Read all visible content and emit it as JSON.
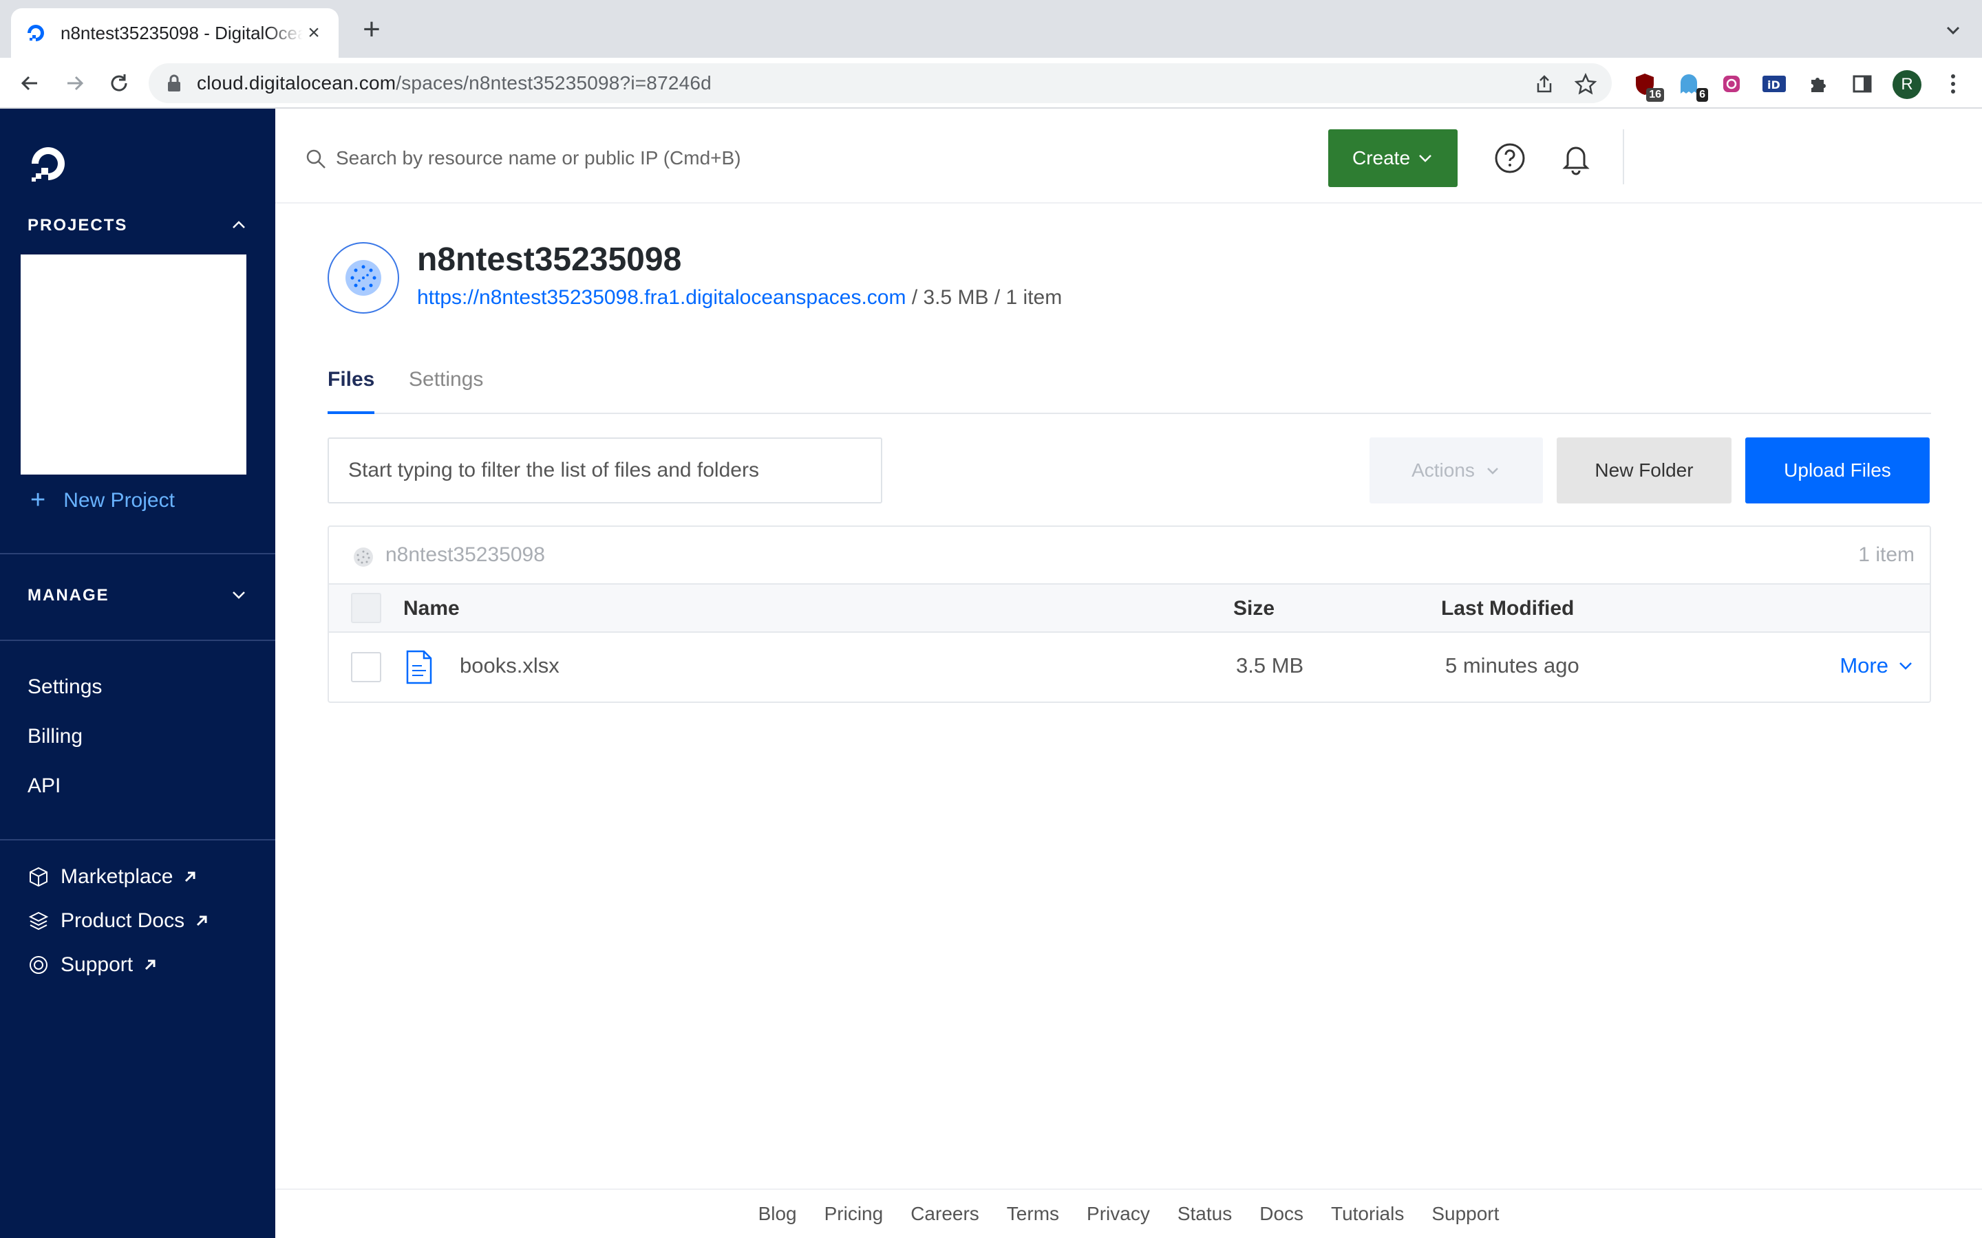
{
  "browser": {
    "tab_title": "n8ntest35235098 - DigitalOcean",
    "url_domain": "cloud.digitalocean.com",
    "url_path": "/spaces/n8ntest35235098?i=87246d",
    "extensions": [
      {
        "name": "ublock-icon",
        "badge": "16"
      },
      {
        "name": "ghost-extension-icon",
        "badge": "6"
      },
      {
        "name": "instagram-extension-icon",
        "badge": ""
      },
      {
        "name": "id-extension-icon",
        "badge": ""
      }
    ],
    "profile_initial": "R"
  },
  "sidebar": {
    "projects_heading": "PROJECTS",
    "new_project_label": "New Project",
    "manage_heading": "MANAGE",
    "links": [
      "Settings",
      "Billing",
      "API"
    ],
    "external_links": [
      "Marketplace",
      "Product Docs",
      "Support"
    ]
  },
  "header": {
    "search_placeholder": "Search by resource name or public IP (Cmd+B)",
    "create_label": "Create"
  },
  "bucket": {
    "name": "n8ntest35235098",
    "endpoint": "https://n8ntest35235098.fra1.digitaloceanspaces.com",
    "summary": " / 3.5 MB / 1 item"
  },
  "tabs": [
    "Files",
    "Settings"
  ],
  "toolbar": {
    "filter_placeholder": "Start typing to filter the list of files and folders",
    "actions_label": "Actions",
    "new_folder_label": "New Folder",
    "upload_label": "Upload Files"
  },
  "table": {
    "breadcrumb": "n8ntest35235098",
    "item_count": "1 item",
    "columns": [
      "Name",
      "Size",
      "Last Modified"
    ],
    "rows": [
      {
        "name": "books.xlsx",
        "size": "3.5 MB",
        "modified": "5 minutes ago",
        "action": "More"
      }
    ]
  },
  "footer": [
    "Blog",
    "Pricing",
    "Careers",
    "Terms",
    "Privacy",
    "Status",
    "Docs",
    "Tutorials",
    "Support"
  ],
  "colors": {
    "sidebar_bg": "#031b4e",
    "accent_blue": "#0069ff",
    "create_green": "#2e7d32"
  }
}
